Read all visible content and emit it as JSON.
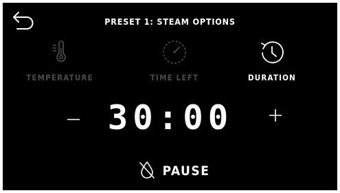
{
  "header": {
    "title": "PRESET 1: STEAM OPTIONS",
    "back_icon": "back-arrow-icon"
  },
  "options": [
    {
      "label": "TEMPERATURE",
      "icon": "thermometer-icon",
      "active": false
    },
    {
      "label": "TIME LEFT",
      "icon": "timer-dial-icon",
      "active": false
    },
    {
      "label": "DURATION",
      "icon": "clock-refresh-icon",
      "active": true
    }
  ],
  "controls": {
    "decrement_icon": "minus-icon",
    "increment_icon": "plus-icon",
    "time_value": "30:00"
  },
  "action": {
    "label": "PAUSE",
    "icon": "no-water-icon"
  },
  "colors": {
    "background": "#000000",
    "active": "#ffffff",
    "inactive": "#4a4a4a"
  }
}
